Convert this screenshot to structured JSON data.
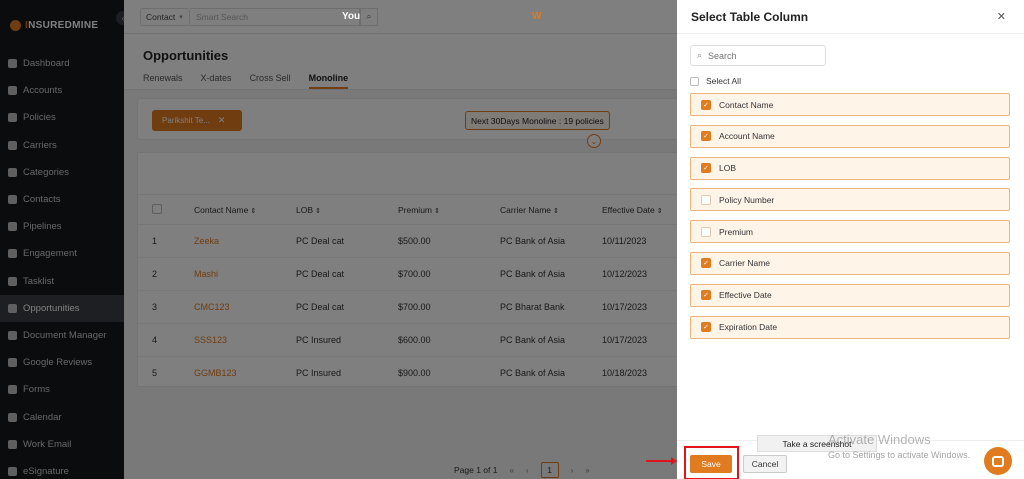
{
  "brand": {
    "name_a": "I",
    "name_b": "NSUREDMINE"
  },
  "sidebar": {
    "collapse_icon": "‹",
    "items": [
      {
        "label": "Dashboard",
        "icon": "dashboard-icon"
      },
      {
        "label": "Accounts",
        "icon": "accounts-icon"
      },
      {
        "label": "Policies",
        "icon": "policies-icon"
      },
      {
        "label": "Carriers",
        "icon": "carriers-icon"
      },
      {
        "label": "Categories",
        "icon": "categories-icon"
      },
      {
        "label": "Contacts",
        "icon": "contacts-icon"
      },
      {
        "label": "Pipelines",
        "icon": "pipelines-icon"
      },
      {
        "label": "Engagement",
        "icon": "engagement-icon"
      },
      {
        "label": "Tasklist",
        "icon": "tasklist-icon"
      },
      {
        "label": "Opportunities",
        "icon": "opportunities-icon",
        "active": true
      },
      {
        "label": "Document Manager",
        "icon": "document-icon"
      },
      {
        "label": "Google Reviews",
        "icon": "google-icon"
      },
      {
        "label": "Forms",
        "icon": "forms-icon"
      },
      {
        "label": "Calendar",
        "icon": "calendar-icon"
      },
      {
        "label": "Work Email",
        "icon": "email-icon"
      },
      {
        "label": "eSignature",
        "icon": "signature-icon"
      }
    ]
  },
  "topbar": {
    "contact_select": "Contact",
    "search_placeholder": "Smart Search",
    "you_label": "You",
    "user_initial": "W"
  },
  "page": {
    "title": "Opportunities",
    "tabs": [
      "Renewals",
      "X-dates",
      "Cross Sell",
      "Monoline"
    ],
    "active_tab": "Monoline",
    "filter_chip": "Parikshit Te...",
    "count_badge": "Next 30Days  Monoline : 19 policies"
  },
  "table": {
    "headers": [
      "Contact Name",
      "LOB",
      "Premium",
      "Carrier Name",
      "Effective Date"
    ],
    "rows": [
      {
        "num": "1",
        "contact": "Zeeka",
        "lob": "PC Deal cat",
        "premium": "$500.00",
        "carrier": "PC Bank of Asia",
        "date": "10/11/2023"
      },
      {
        "num": "2",
        "contact": "Mashi",
        "lob": "PC Deal cat",
        "premium": "$700.00",
        "carrier": "PC Bank of Asia",
        "date": "10/12/2023"
      },
      {
        "num": "3",
        "contact": "CMC123",
        "lob": "PC Deal cat",
        "premium": "$700.00",
        "carrier": "PC Bharat Bank",
        "date": "10/17/2023"
      },
      {
        "num": "4",
        "contact": "SSS123",
        "lob": "PC Insured",
        "premium": "$600.00",
        "carrier": "PC Bank of Asia",
        "date": "10/17/2023"
      },
      {
        "num": "5",
        "contact": "GGMB123",
        "lob": "PC Insured",
        "premium": "$900.00",
        "carrier": "PC Bank of Asia",
        "date": "10/18/2023"
      }
    ]
  },
  "pager": {
    "label": "Page 1 of 1",
    "first": "«",
    "prev": "‹",
    "current": "1",
    "next": "›",
    "last": "»"
  },
  "drawer": {
    "title": "Select Table Column",
    "close": "✕",
    "search_placeholder": "Search",
    "select_all": "Select All",
    "columns": [
      {
        "label": "Contact Name",
        "checked": true
      },
      {
        "label": "Account Name",
        "checked": true
      },
      {
        "label": "LOB",
        "checked": true
      },
      {
        "label": "Policy Number",
        "checked": false
      },
      {
        "label": "Premium",
        "checked": false
      },
      {
        "label": "Carrier Name",
        "checked": true
      },
      {
        "label": "Effective Date",
        "checked": true
      },
      {
        "label": "Expiration Date",
        "checked": true
      }
    ],
    "save": "Save",
    "cancel": "Cancel"
  },
  "overlay": {
    "tooltip": "Take a screenshot",
    "watermark_title": "Activate Windows",
    "watermark_sub": "Go to Settings to activate Windows."
  },
  "colors": {
    "accent": "#e07b20",
    "highlight": "#e0141c",
    "sidebar": "#16181c"
  }
}
